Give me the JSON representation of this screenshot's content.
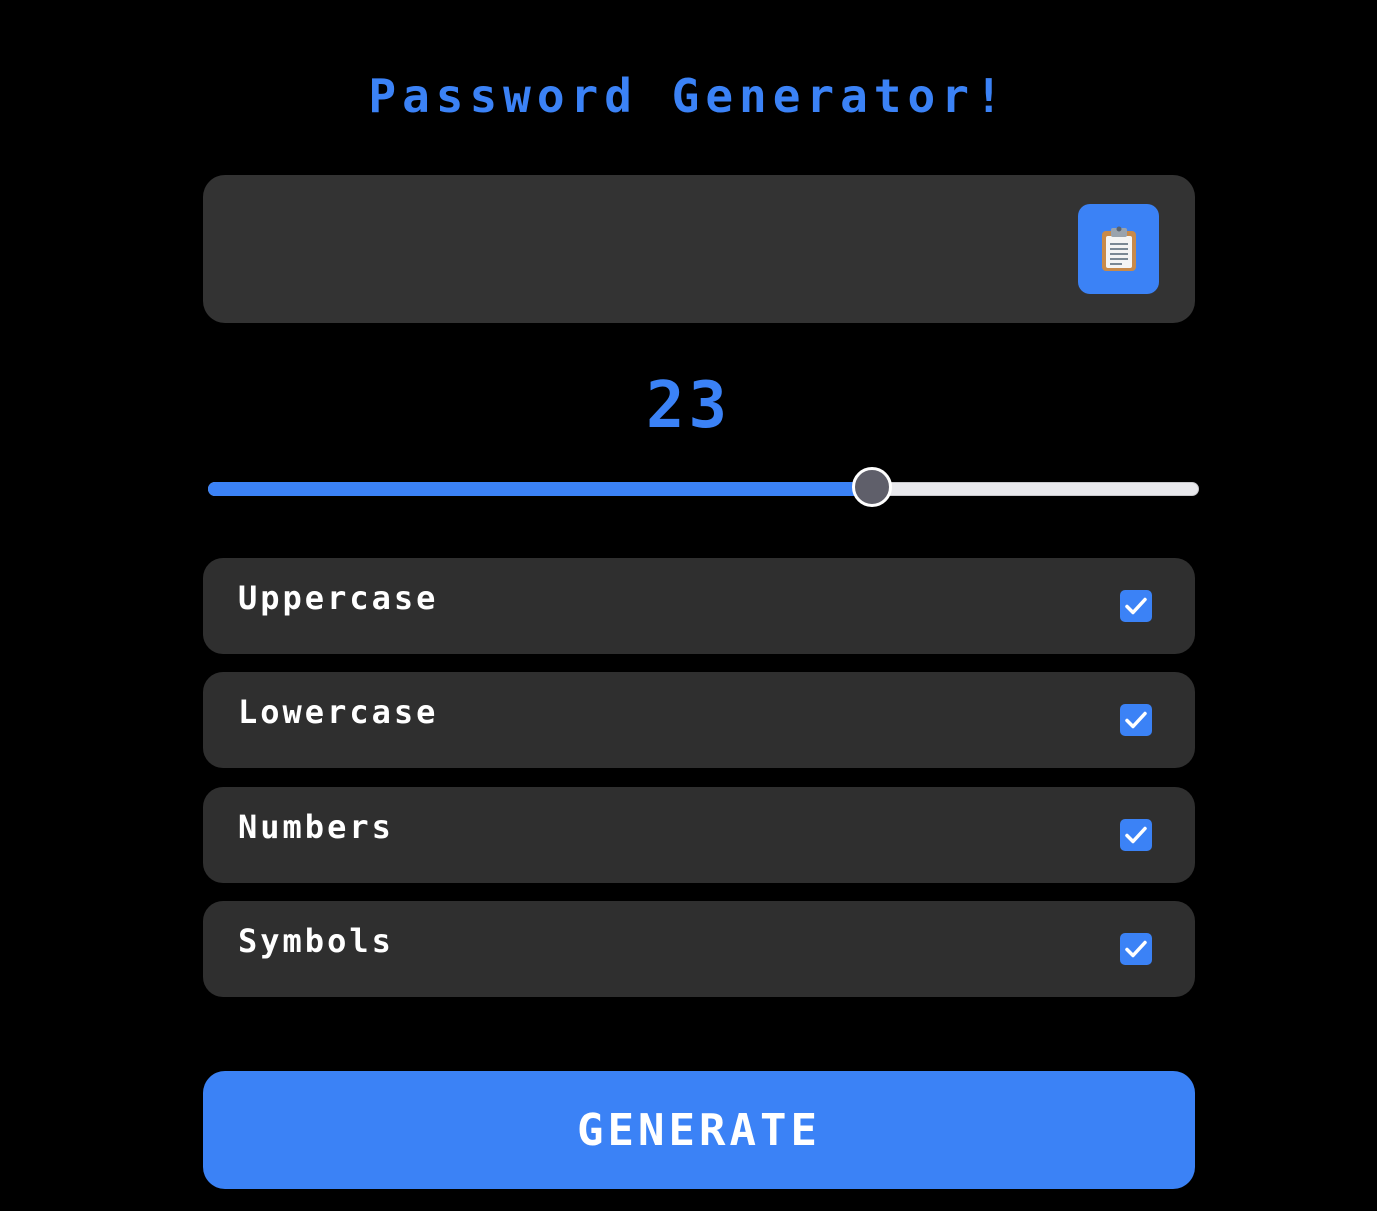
{
  "header": {
    "title": "Password Generator!"
  },
  "password": {
    "value": "",
    "placeholder": "",
    "copy_icon": "clipboard-icon"
  },
  "length": {
    "value": "23",
    "slider_fraction": 0.67
  },
  "options": [
    {
      "label": "Uppercase",
      "checked": true
    },
    {
      "label": "Lowercase",
      "checked": true
    },
    {
      "label": "Numbers",
      "checked": true
    },
    {
      "label": "Symbols",
      "checked": true
    }
  ],
  "actions": {
    "generate_label": "GENERATE"
  },
  "colors": {
    "accent": "#3b82f6",
    "background": "#000000",
    "panel": "#333333",
    "row": "#2f2f2f",
    "text": "#ffffff"
  }
}
